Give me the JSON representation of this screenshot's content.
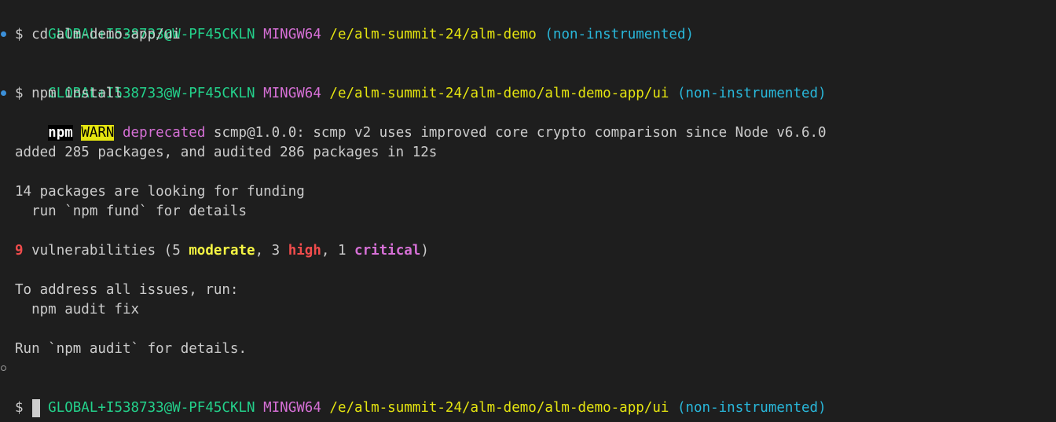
{
  "prompt1": {
    "user": "GLOBAL+I538733@W-PF45CKLN",
    "system": "MINGW64",
    "path": "/e/alm-summit-24/alm-demo",
    "branch": "(non-instrumented)"
  },
  "cmd1": "$ cd alm-demo-app/ui",
  "prompt2": {
    "user": "GLOBAL+I538733@W-PF45CKLN",
    "system": "MINGW64",
    "path": "/e/alm-summit-24/alm-demo/alm-demo-app/ui",
    "branch": "(non-instrumented)"
  },
  "cmd2": "$ npm install",
  "warn": {
    "npm": "npm",
    "level": "WARN",
    "tag": "deprecated",
    "message": "scmp@1.0.0: scmp v2 uses improved core crypto comparison since Node v6.6.0"
  },
  "added": "added 285 packages, and audited 286 packages in 12s",
  "funding": "14 packages are looking for funding",
  "fund_hint": "  run `npm fund` for details",
  "vuln": {
    "count": "9",
    "label": " vulnerabilities (5 ",
    "moderate": "moderate",
    "sep1": ", 3 ",
    "high": "high",
    "sep2": ", 1 ",
    "critical": "critical",
    "close": ")"
  },
  "address": "To address all issues, run:",
  "fix": "  npm audit fix",
  "details": "Run `npm audit` for details.",
  "prompt3": {
    "user": "GLOBAL+I538733@W-PF45CKLN",
    "system": "MINGW64",
    "path": "/e/alm-summit-24/alm-demo/alm-demo-app/ui",
    "branch": "(non-instrumented)"
  },
  "cmd3": "$ ",
  "colors": {
    "background": "#1e1e1e",
    "foreground": "#cccccc",
    "user": "#23d18b",
    "system": "#d670d6",
    "path": "#e5e510",
    "branch": "#29b8db",
    "error": "#f14c4c",
    "decoration_success": "#3b8fd8"
  }
}
